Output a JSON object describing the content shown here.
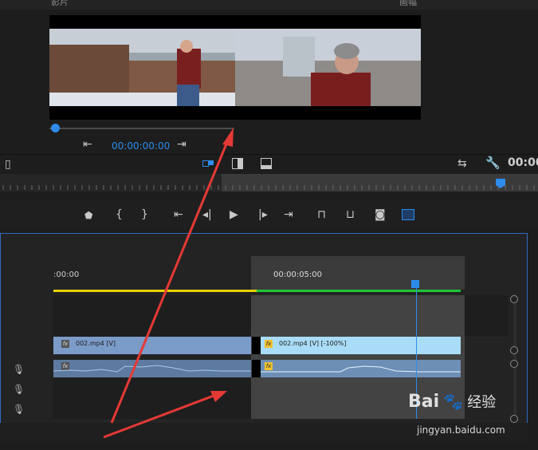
{
  "source_monitor": {
    "header_left_partial": "影片",
    "header_right_partial": "画幅",
    "timecode": "00:00:00:00",
    "playback_percent": 0
  },
  "program_monitor": {
    "timecode_partial": "00:00"
  },
  "timeline": {
    "ruler_start": ":00:00",
    "ruler_mid": "00:00:05:00",
    "tracks": {
      "video_clip_1": "002.mp4 [V]",
      "video_clip_2": "002.mp4 [V] [-100%]",
      "fx_label": "fx"
    }
  },
  "watermark": {
    "brand": "Bai",
    "brand_suffix": "经验",
    "url": "jingyan.baidu.com"
  },
  "colors": {
    "accent": "#2d8ceb",
    "arrow": "#e53935",
    "work_area_yellow": "#e8d000",
    "render_green": "#22c43a"
  }
}
